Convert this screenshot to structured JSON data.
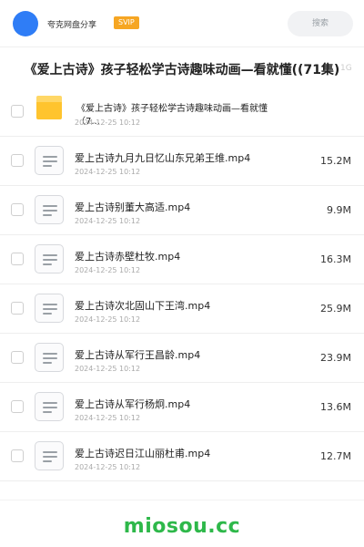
{
  "header": {
    "share_name": "夸克网盘分享",
    "badge": "SVIP",
    "search_label": "搜索"
  },
  "folder": {
    "title": "《爱上古诗》孩子轻松学古诗趣味动画—看就懂((71集)",
    "size_ghost": "1G"
  },
  "items": [
    {
      "type": "folder",
      "name": "《爱上古诗》孩子轻松学古诗趣味动画—看就懂（7...",
      "date": "2024-12-25 10:12",
      "size": ""
    },
    {
      "type": "file",
      "name": "爱上古诗九月九日忆山东兄弟王维.mp4",
      "date": "2024-12-25 10:12",
      "size": "15.2M"
    },
    {
      "type": "file",
      "name": "爱上古诗别董大高适.mp4",
      "date": "2024-12-25 10:12",
      "size": "9.9M"
    },
    {
      "type": "file",
      "name": "爱上古诗赤壁杜牧.mp4",
      "date": "2024-12-25 10:12",
      "size": "16.3M"
    },
    {
      "type": "file",
      "name": "爱上古诗次北固山下王湾.mp4",
      "date": "2024-12-25 10:12",
      "size": "25.9M"
    },
    {
      "type": "file",
      "name": "爱上古诗从军行王昌龄.mp4",
      "date": "2024-12-25 10:12",
      "size": "23.9M"
    },
    {
      "type": "file",
      "name": "爱上古诗从军行杨炯.mp4",
      "date": "2024-12-25 10:12",
      "size": "13.6M"
    },
    {
      "type": "file",
      "name": "爱上古诗迟日江山丽杜甫.mp4",
      "date": "2024-12-25 10:12",
      "size": "12.7M"
    }
  ],
  "watermark": "miosou.cc",
  "colors": {
    "accent": "#2f7df6",
    "svip": "#f6a623",
    "folder": "#ffc42e",
    "watermark": "#2eb84a"
  }
}
